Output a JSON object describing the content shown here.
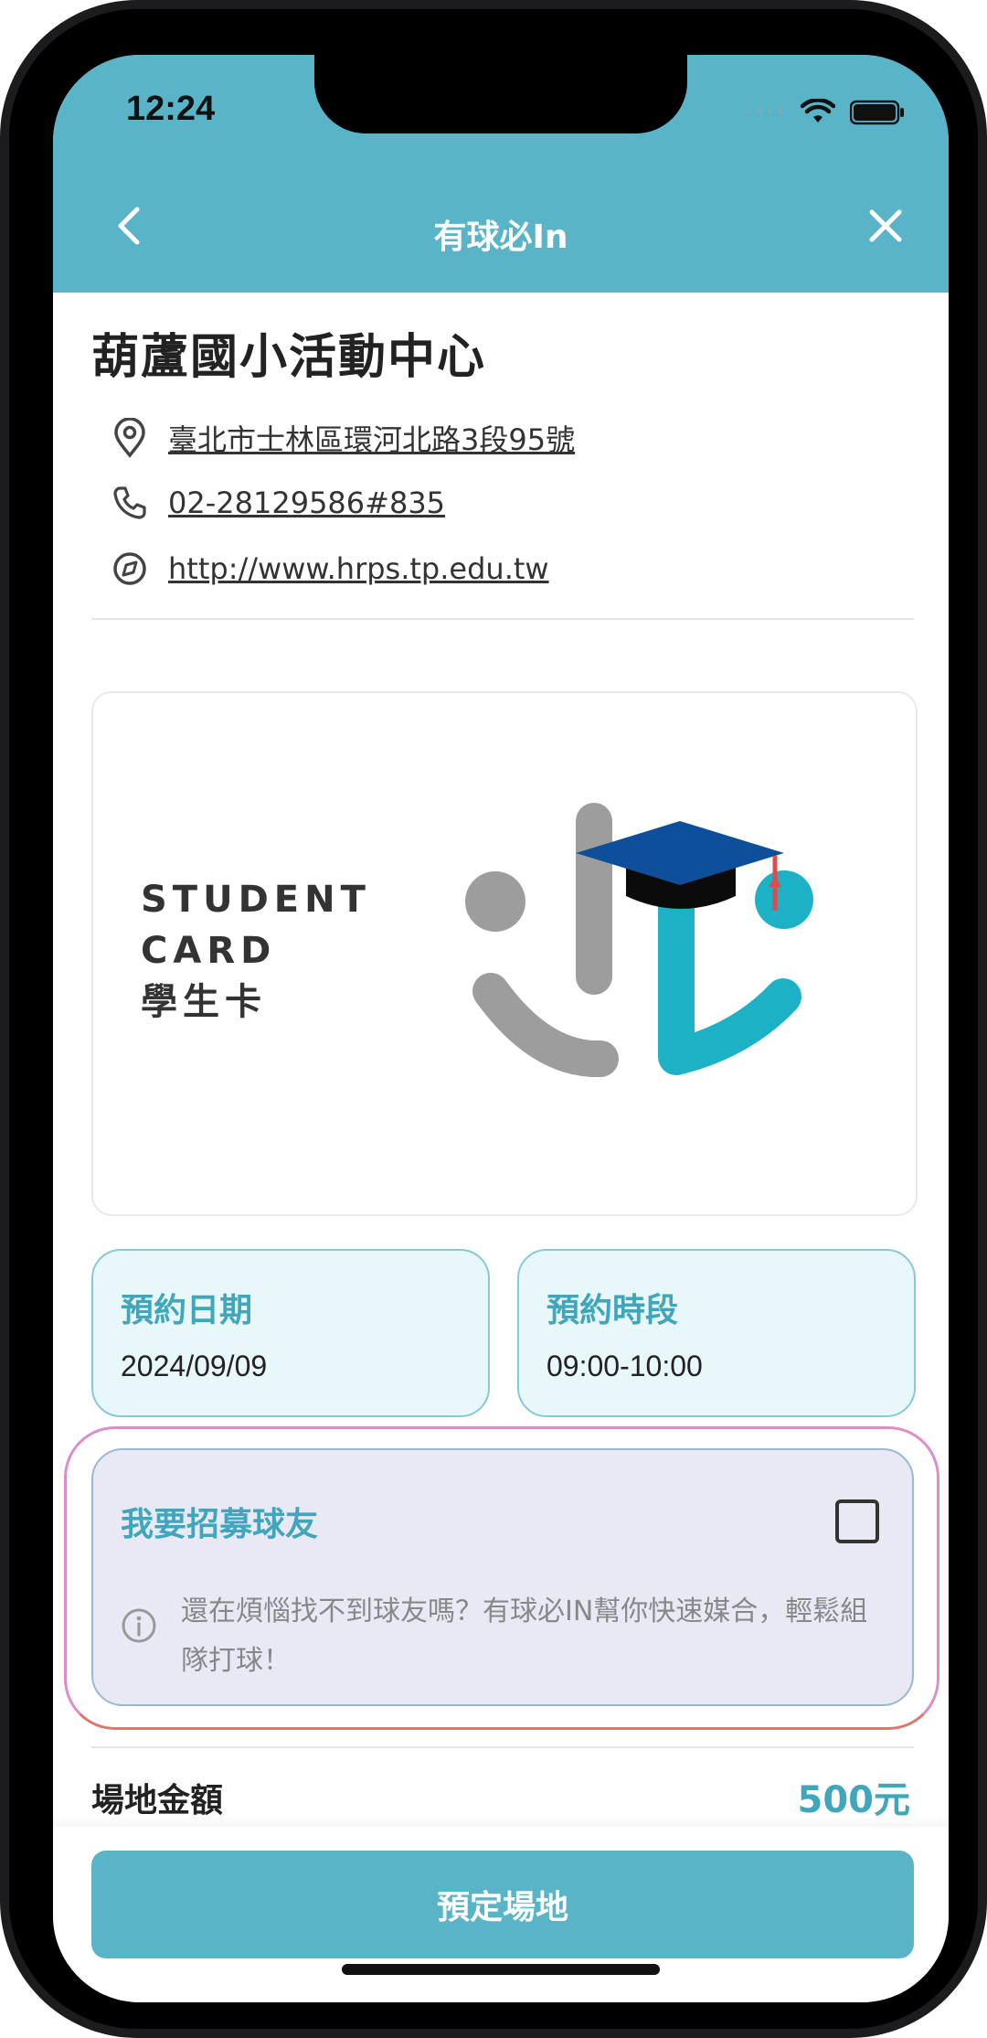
{
  "status_bar": {
    "time": "12:24"
  },
  "nav": {
    "title": "有球必In"
  },
  "venue": {
    "name": "葫蘆國小活動中心",
    "address": "臺北市士林區環河北路3段95號",
    "phone": "02-28129586#835",
    "website": "http://www.hrps.tp.edu.tw"
  },
  "card": {
    "line1": "STUDENT",
    "line2": "CARD",
    "line3": "學生卡"
  },
  "booking": {
    "date_label": "預約日期",
    "date_value": "2024/09/09",
    "time_label": "預約時段",
    "time_value": "09:00-10:00"
  },
  "recruit": {
    "title": "我要招募球友",
    "description": "還在煩惱找不到球友嗎？有球必IN幫你快速媒合，輕鬆組隊打球！"
  },
  "price": {
    "label": "場地金額",
    "value": "500元"
  },
  "actions": {
    "book_label": "預定場地"
  },
  "colors": {
    "accent": "#5ab4c7",
    "accent_text": "#3fa6bb",
    "slot_bg": "#e8f7fa",
    "recruit_bg": "#e9e9f6"
  },
  "icons": [
    "chevron-left-icon",
    "close-icon",
    "location-pin-icon",
    "phone-icon",
    "compass-icon",
    "info-icon",
    "wifi-icon",
    "battery-icon",
    "cellular-icon",
    "graduation-cap-icon"
  ]
}
